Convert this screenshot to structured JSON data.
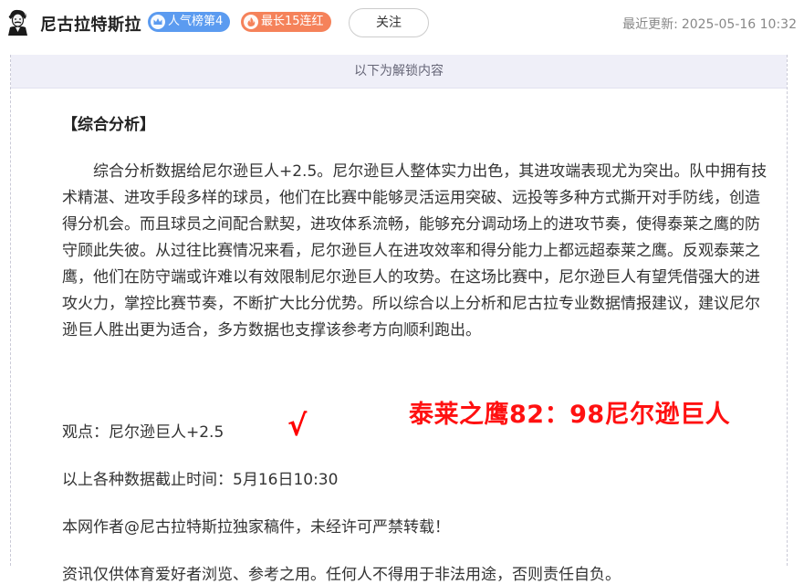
{
  "author": {
    "name": "尼古拉特斯拉",
    "avatar_icon": "nikola-tesla-portrait-icon"
  },
  "badges": {
    "rank": {
      "label": "人气榜第4",
      "icon": "crown-icon",
      "color": "#5b9bf0"
    },
    "streak": {
      "label": "最长15连红",
      "icon": "flame-icon",
      "color": "#f5825a"
    }
  },
  "follow_button": {
    "label": "关注"
  },
  "update": {
    "label": "最近更新:",
    "time": "2025-05-16 10:32"
  },
  "unlock_notice": "以下为解锁内容",
  "article": {
    "section_title": "【综合分析】",
    "paragraph": "综合分析数据给尼尔逊巨人+2.5。尼尔逊巨人整体实力出色，其进攻端表现尤为突出。队中拥有技术精湛、进攻手段多样的球员，他们在比赛中能够灵活运用突破、远投等多种方式撕开对手防线，创造得分机会。而且球员之间配合默契，进攻体系流畅，能够充分调动场上的进攻节奏，使得泰莱之鹰的防守顾此失彼。从过往比赛情况来看，尼尔逊巨人在进攻效率和得分能力上都远超泰莱之鹰。反观泰莱之鹰，他们在防守端或许难以有效限制尼尔逊巨人的攻势。在这场比赛中，尼尔逊巨人有望凭借强大的进攻火力，掌控比赛节奏，不断扩大比分优势。所以综合以上分析和尼古拉专业数据情报建议，建议尼尔逊巨人胜出更为适合，多方数据也支撑该参考方向顺利跑出。",
    "viewpoint": "观点：尼尔逊巨人+2.5",
    "checkmark": "√",
    "score_result": "泰莱之鹰82：98尼尔逊巨人",
    "cutoff": "以上各种数据截止时间：5月16日10:30",
    "copyright": "本网作者@尼古拉特斯拉独家稿件，未经许可严禁转载！",
    "disclaimer": "资讯仅供体育爱好者浏览、参考之用。任何人不得用于非法用途，否则责任自负。"
  },
  "colors": {
    "accent_red": "#ff1111",
    "unlock_bg": "#efeff8"
  }
}
